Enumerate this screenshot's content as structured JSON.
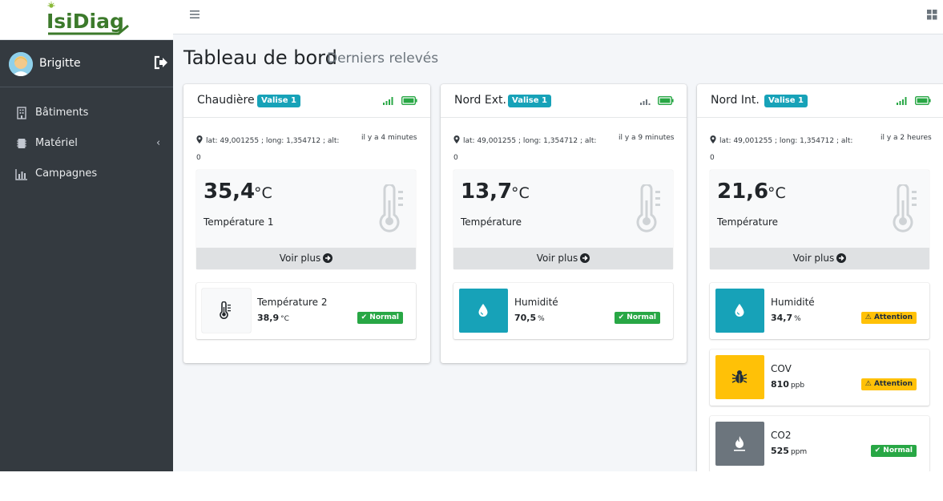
{
  "brand": {
    "logo_text": "IsiDiag"
  },
  "user": {
    "name": "Brigitte"
  },
  "nav": [
    {
      "label": "Bâtiments",
      "icon": "building-icon"
    },
    {
      "label": "Matériel",
      "icon": "device-icon",
      "chevron": "‹"
    },
    {
      "label": "Campagnes",
      "icon": "bar-chart-icon"
    }
  ],
  "page": {
    "title": "Tableau de bord",
    "subtitle": "Derniers relevés"
  },
  "cards": [
    {
      "title": "Chaudière",
      "badge": "Valise 1",
      "location": "lat: 49,001255 ; long: 1,354712 ; alt:",
      "alt": "0",
      "time": "il y a 4 minutes",
      "main": {
        "value": "35,4",
        "unit": "°C",
        "label": "Température 1"
      },
      "more": "Voir plus",
      "sensors": [
        {
          "name": "Température 2",
          "value": "38,9",
          "unit": "°C",
          "status": "Normal",
          "kind": "ok",
          "icon": "thermometer-icon"
        }
      ]
    },
    {
      "title": "Nord Ext.",
      "badge": "Valise 1",
      "location": "lat: 49,001255 ; long: 1,354712 ; alt:",
      "alt": "0",
      "time": "il y a 9 minutes",
      "main": {
        "value": "13,7",
        "unit": "°C",
        "label": "Température"
      },
      "more": "Voir plus",
      "sensors": [
        {
          "name": "Humidité",
          "value": "70,5",
          "unit": "%",
          "status": "Normal",
          "kind": "ok",
          "icon": "droplet-icon"
        }
      ]
    },
    {
      "title": "Nord Int.",
      "badge": "Valise 1",
      "location": "lat: 49,001255 ; long: 1,354712 ; alt:",
      "alt": "0",
      "time": "il y a 2 heures",
      "main": {
        "value": "21,6",
        "unit": "°C",
        "label": "Température"
      },
      "more": "Voir plus",
      "sensors": [
        {
          "name": "Humidité",
          "value": "34,7",
          "unit": "%",
          "status": "Attention",
          "kind": "warn",
          "icon": "droplet-icon"
        },
        {
          "name": "COV",
          "value": "810",
          "unit": "ppb",
          "status": "Attention",
          "kind": "warn",
          "icon": "bug-icon"
        },
        {
          "name": "CO2",
          "value": "525",
          "unit": "ppm",
          "status": "Normal",
          "kind": "ok",
          "icon": "flame-icon"
        }
      ]
    }
  ],
  "colors": {
    "sidebar": "#343a40",
    "info": "#17a2b8",
    "success": "#28a745",
    "warning": "#ffc107",
    "gray": "#6c757d",
    "brand": "#3c7a2b"
  }
}
